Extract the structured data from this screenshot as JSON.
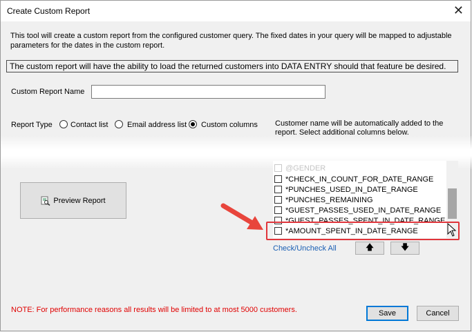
{
  "window": {
    "title": "Create Custom Report"
  },
  "intro_text": "This tool will create a custom report from the configured customer query.  The fixed dates in your query will be mapped to adjustable parameters for the dates in the custom report.",
  "data_entry_note": "The custom report will have the ability to load the returned customers into DATA ENTRY should that feature be desired.",
  "report_name": {
    "label": "Custom Report Name",
    "value": ""
  },
  "report_type": {
    "label": "Report Type",
    "options": [
      "Contact list",
      "Email address list",
      "Custom columns"
    ],
    "selected": "Custom columns"
  },
  "customer_note": "Customer name will be automatically added to the report.  Select additional columns below.",
  "preview_button": "Preview Report",
  "columns": [
    {
      "label": "@GENDER",
      "checked": false
    },
    {
      "label": "*CHECK_IN_COUNT_FOR_DATE_RANGE",
      "checked": false
    },
    {
      "label": "*PUNCHES_USED_IN_DATE_RANGE",
      "checked": false
    },
    {
      "label": "*PUNCHES_REMAINING",
      "checked": false
    },
    {
      "label": "*GUEST_PASSES_USED_IN_DATE_RANGE",
      "checked": false
    },
    {
      "label": "*GUEST_PASSES_SPENT_IN_DATE_RANGE",
      "checked": false
    },
    {
      "label": "*AMOUNT_SPENT_IN_DATE_RANGE",
      "checked": false
    }
  ],
  "check_uncheck_link": "Check/Uncheck All",
  "move_up_glyph": "🡅",
  "move_down_glyph": "🡇",
  "footer_note": "NOTE:  For performance reasons all results will be limited to at most 5000 customers.",
  "save_button": "Save",
  "cancel_button": "Cancel",
  "colors": {
    "highlight": "#e0343a",
    "note": "#e00000",
    "link": "#1a5fb4",
    "default_button_border": "#0078d7"
  }
}
